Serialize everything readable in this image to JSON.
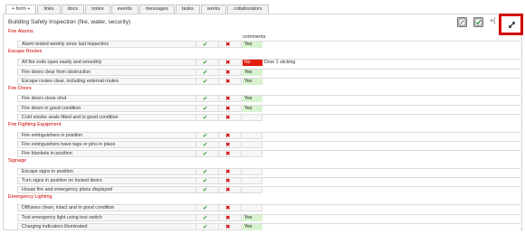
{
  "tabs": [
    "+ form +",
    "links",
    "docs",
    "notes",
    "events",
    "messages",
    "tasks",
    "works",
    "collaborators"
  ],
  "form": {
    "title": "Building Safety Inspection (fire, water, security)",
    "comments_header": "comments",
    "toolbar_more": "+(",
    "icons": [
      "edit-icon",
      "check-icon",
      "expand-icon"
    ]
  },
  "sections": [
    {
      "title": "Fire Alarms",
      "items": [
        {
          "label": "Alarm tested weekly since last inspection",
          "value": "Yes",
          "comment": ""
        }
      ]
    },
    {
      "title": "Escape Routes",
      "items": [
        {
          "label": "All fire exits open easily and smoothly",
          "value": "No",
          "comment": "Door 1 sticking"
        },
        {
          "label": "Fire doors clear from obstruction",
          "value": "Yes",
          "comment": ""
        },
        {
          "label": "Escape routes clear, including external routes",
          "value": "Yes",
          "comment": ""
        }
      ]
    },
    {
      "title": "Fire Doors",
      "items": [
        {
          "label": "Fire doors close shut",
          "value": "Yes",
          "comment": ""
        },
        {
          "label": "Fire doors in good condition",
          "value": "Yes",
          "comment": ""
        },
        {
          "label": "Cold smoke seals fitted and in good condition",
          "value": "",
          "comment": ""
        }
      ]
    },
    {
      "title": "Fire Fighting Equipment",
      "items": [
        {
          "label": "Fire extinguishers in position",
          "value": "",
          "comment": ""
        },
        {
          "label": "Fire extinguishers have tags or pins in place",
          "value": "",
          "comment": ""
        },
        {
          "label": "Fire blankets in position",
          "value": "",
          "comment": ""
        }
      ]
    },
    {
      "title": "Signage",
      "items": [
        {
          "label": "Escape signs in position",
          "value": "",
          "comment": ""
        },
        {
          "label": "Turn signs in position on locked doors",
          "value": "",
          "comment": ""
        },
        {
          "label": "House fire and emergency plans displayed",
          "value": "",
          "comment": ""
        }
      ]
    },
    {
      "title": "Emergency Lighting",
      "items": [
        {
          "label": "Diffusers clean, intact and in good condition",
          "value": "",
          "comment": ""
        },
        {
          "label": "Test emergency light using test switch",
          "value": "Yes",
          "comment": ""
        },
        {
          "label": "Charging indicators illuminated",
          "value": "Yes",
          "comment": ""
        }
      ]
    }
  ],
  "colors": {
    "accent_red": "#cc0000",
    "yes_bg": "#d8f3d0",
    "no_bg": "#e01e0e",
    "check_green": "#2a9a2a"
  }
}
